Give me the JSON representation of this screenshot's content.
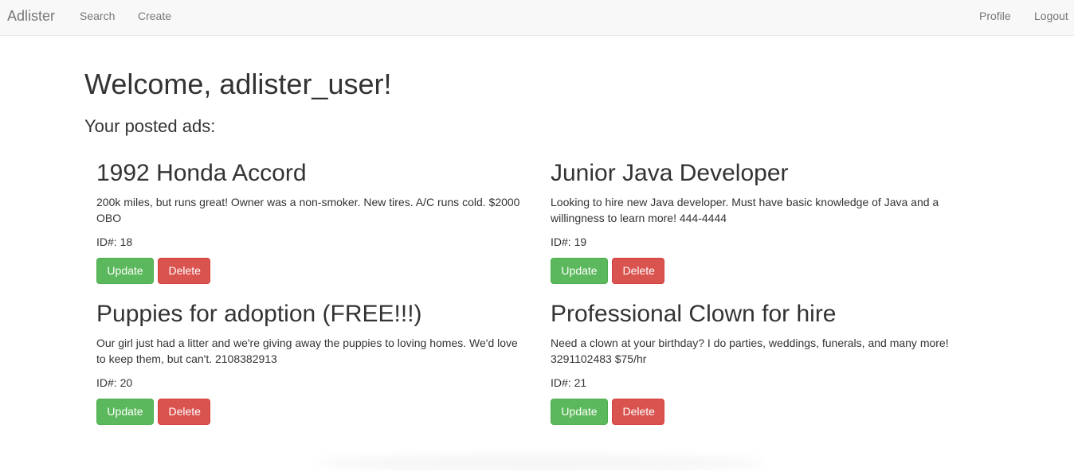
{
  "navbar": {
    "brand": "Adlister",
    "left_links": [
      "Search",
      "Create"
    ],
    "right_links": [
      "Profile",
      "Logout"
    ]
  },
  "main": {
    "welcome": "Welcome, adlister_user!",
    "subheading": "Your posted ads:"
  },
  "ads": [
    {
      "title": "1992 Honda Accord",
      "description": "200k miles, but runs great! Owner was a non-smoker. New tires. A/C runs cold. $2000 OBO",
      "id_text": "ID#: 18",
      "update_label": "Update",
      "delete_label": "Delete"
    },
    {
      "title": "Junior Java Developer",
      "description": "Looking to hire new Java developer. Must have basic knowledge of Java and a willingness to learn more! 444-4444",
      "id_text": "ID#: 19",
      "update_label": "Update",
      "delete_label": "Delete"
    },
    {
      "title": "Puppies for adoption (FREE!!!)",
      "description": "Our girl just had a litter and we're giving away the puppies to loving homes. We'd love to keep them, but can't. 2108382913",
      "id_text": "ID#: 20",
      "update_label": "Update",
      "delete_label": "Delete"
    },
    {
      "title": "Professional Clown for hire",
      "description": "Need a clown at your birthday? I do parties, weddings, funerals, and many more! 3291102483 $75/hr",
      "id_text": "ID#: 21",
      "update_label": "Update",
      "delete_label": "Delete"
    }
  ],
  "colors": {
    "navbar_bg": "#f8f8f8",
    "nav_text": "#777777",
    "update_button": "#5cb85c",
    "delete_button": "#d9534f"
  }
}
